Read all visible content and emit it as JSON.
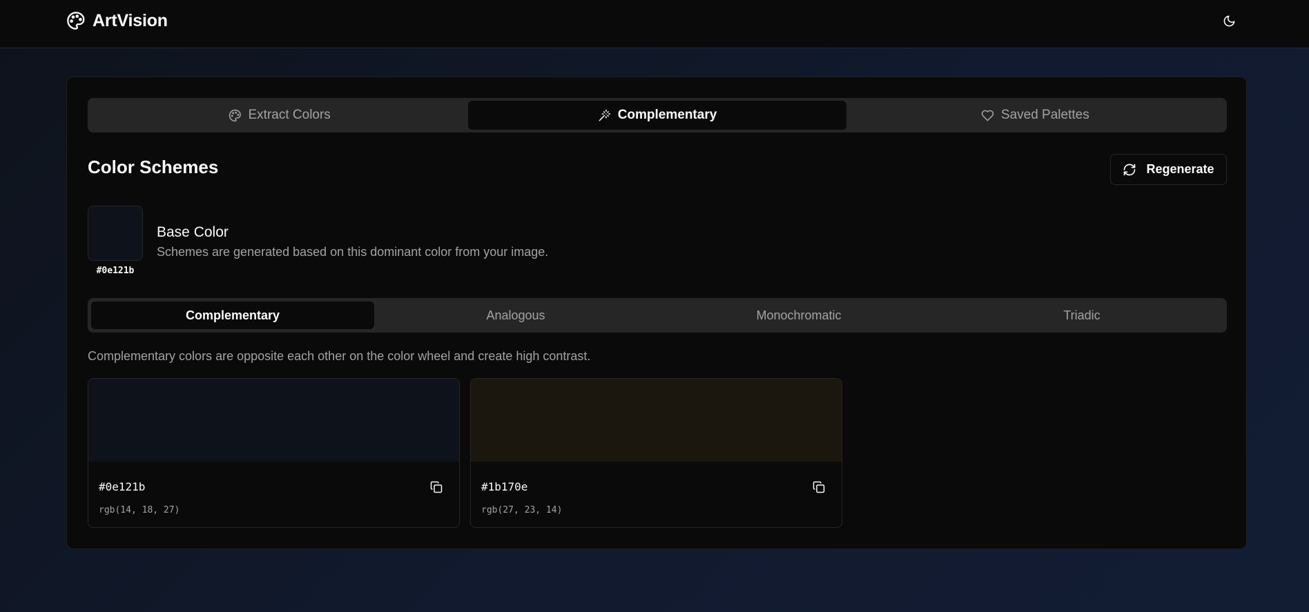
{
  "app": {
    "name": "ArtVision"
  },
  "icons": {
    "brand": "palette-icon",
    "theme_toggle": "moon-icon",
    "regenerate": "refresh-icon",
    "copy": "copy-icon"
  },
  "main_tabs": [
    {
      "label": "Extract Colors",
      "icon": "palette-icon",
      "active": false
    },
    {
      "label": "Complementary",
      "icon": "magic-wand-icon",
      "active": true
    },
    {
      "label": "Saved Palettes",
      "icon": "heart-icon",
      "active": false
    }
  ],
  "section": {
    "title": "Color Schemes",
    "regenerate_label": "Regenerate"
  },
  "base_color": {
    "title": "Base Color",
    "description": "Schemes are generated based on this dominant color from your image.",
    "hex": "#0e121b",
    "swatch_color": "#0e121b"
  },
  "scheme_tabs": [
    {
      "label": "Complementary",
      "active": true
    },
    {
      "label": "Analogous",
      "active": false
    },
    {
      "label": "Monochromatic",
      "active": false
    },
    {
      "label": "Triadic",
      "active": false
    }
  ],
  "scheme_description": "Complementary colors are opposite each other on the color wheel and create high contrast.",
  "colors": [
    {
      "hex": "#0e121b",
      "rgb": "rgb(14, 18, 27)",
      "swatch_color": "#0e121b"
    },
    {
      "hex": "#1b170e",
      "rgb": "rgb(27, 23, 14)",
      "swatch_color": "#1b170e"
    }
  ]
}
